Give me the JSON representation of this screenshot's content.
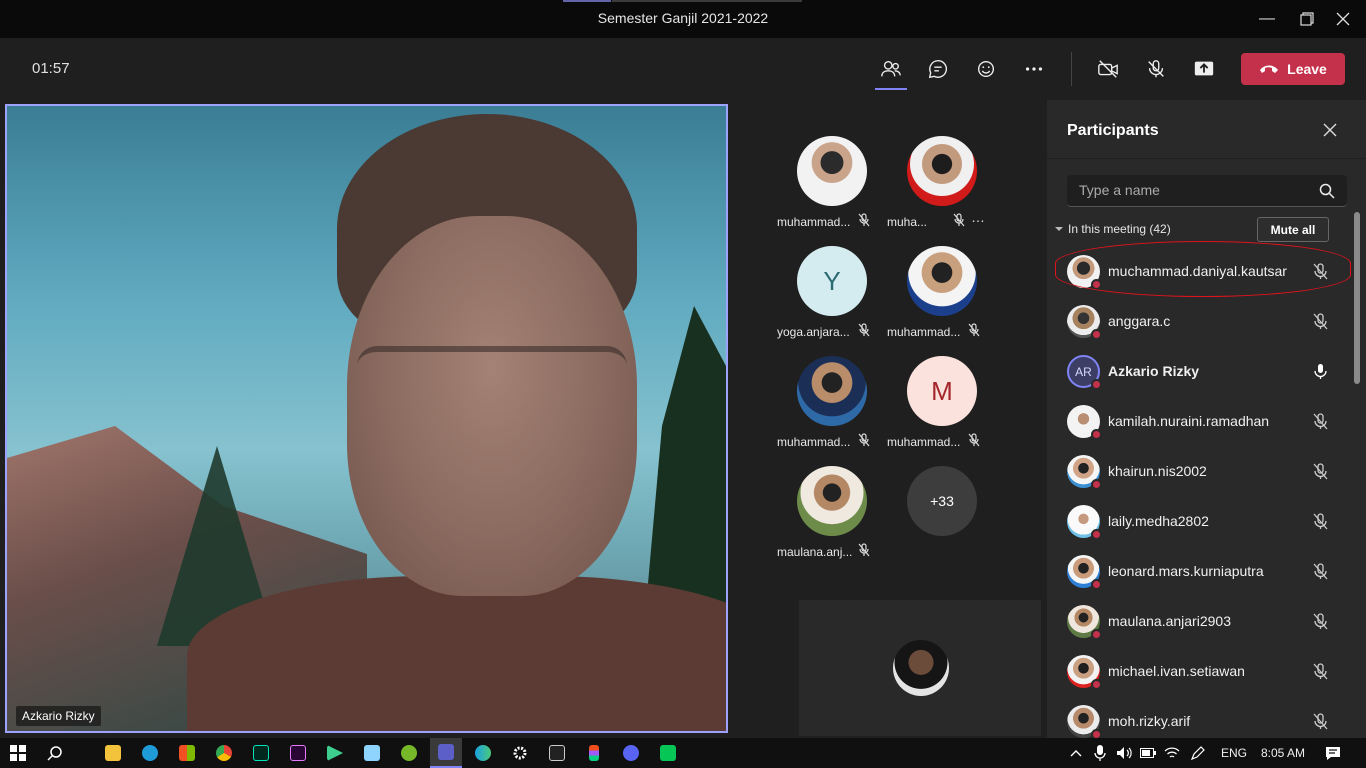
{
  "window": {
    "title": "Semester Ganjil 2021-2022",
    "controls": [
      "minimize-icon",
      "maximize-icon",
      "close-icon"
    ]
  },
  "toolbar": {
    "timer": "01:57",
    "buttons": [
      "people-icon",
      "chat-icon",
      "react-icon",
      "more-icon",
      "camera-off-icon",
      "mic-off-icon",
      "share-icon"
    ],
    "leave_label": "Leave",
    "leave_color": "#c4314b",
    "accent": "#7f85f5"
  },
  "main_video": {
    "name": "Azkario Rizky"
  },
  "gallery": {
    "tiles": [
      {
        "name": "muhammad...",
        "muted": true
      },
      {
        "name": "muha...",
        "muted": true,
        "more": "…"
      },
      {
        "name": "yoga.anjara...",
        "initial": "Y",
        "muted": true
      },
      {
        "name": "muhammad...",
        "muted": true
      },
      {
        "name": "muhammad...",
        "muted": true
      },
      {
        "name": "muhammad...",
        "initial": "M",
        "muted": true
      },
      {
        "name": "maulana.anj...",
        "muted": true
      }
    ],
    "overflow": "+33"
  },
  "participants": {
    "title": "Participants",
    "search_placeholder": "Type a name",
    "section_label": "In this meeting (42)",
    "mute_all_label": "Mute all",
    "list": [
      {
        "name": "muchammad.daniyal.kautsar",
        "muted": true
      },
      {
        "name": "anggara.c",
        "muted": true
      },
      {
        "name": "Azkario Rizky",
        "initials": "AR",
        "muted": false
      },
      {
        "name": "kamilah.nuraini.ramadhan",
        "muted": true
      },
      {
        "name": "khairun.nis2002",
        "muted": true
      },
      {
        "name": "laily.medha2802",
        "muted": true
      },
      {
        "name": "leonard.mars.kurniaputra",
        "muted": true
      },
      {
        "name": "maulana.anjari2903",
        "muted": true
      },
      {
        "name": "michael.ivan.setiawan",
        "muted": true
      },
      {
        "name": "moh.rizky.arif",
        "muted": true
      }
    ]
  },
  "taskbar": {
    "language": "ENG",
    "clock": "8:05 AM"
  }
}
